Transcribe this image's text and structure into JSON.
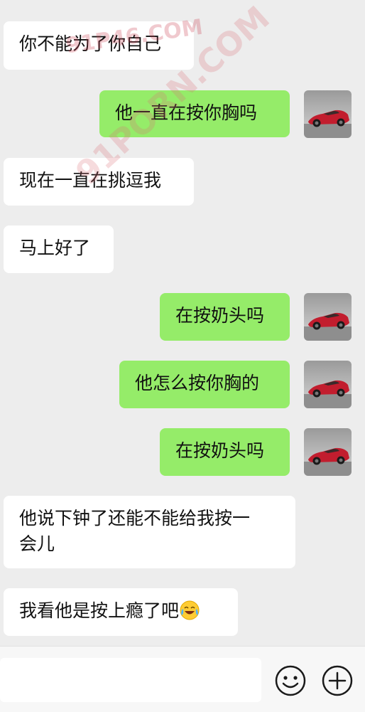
{
  "messages": [
    {
      "side": "in",
      "text": "你不能为了你自己"
    },
    {
      "side": "out",
      "text": "他一直在按你胸吗"
    },
    {
      "side": "in",
      "text": "现在一直在挑逗我"
    },
    {
      "side": "in",
      "text": "马上好了"
    },
    {
      "side": "out",
      "text": "在按奶头吗"
    },
    {
      "side": "out",
      "text": "他怎么按你胸的"
    },
    {
      "side": "out",
      "text": "在按奶头吗"
    },
    {
      "side": "in",
      "line1": "他说下钟了还能不能给我按一",
      "line2": "会儿"
    },
    {
      "side": "in",
      "text": "我看他是按上瘾了吧",
      "emoji": "crying-laughing-emoji"
    }
  ],
  "watermark": {
    "top_text": "91P46.COM",
    "diagonal_text": "91PORN.COM"
  },
  "input_bar": {
    "value": "",
    "emoji_button_icon": "smiley-face-icon",
    "more_button_icon": "plus-circle-icon"
  },
  "avatar_icon": "red-sports-car-avatar"
}
